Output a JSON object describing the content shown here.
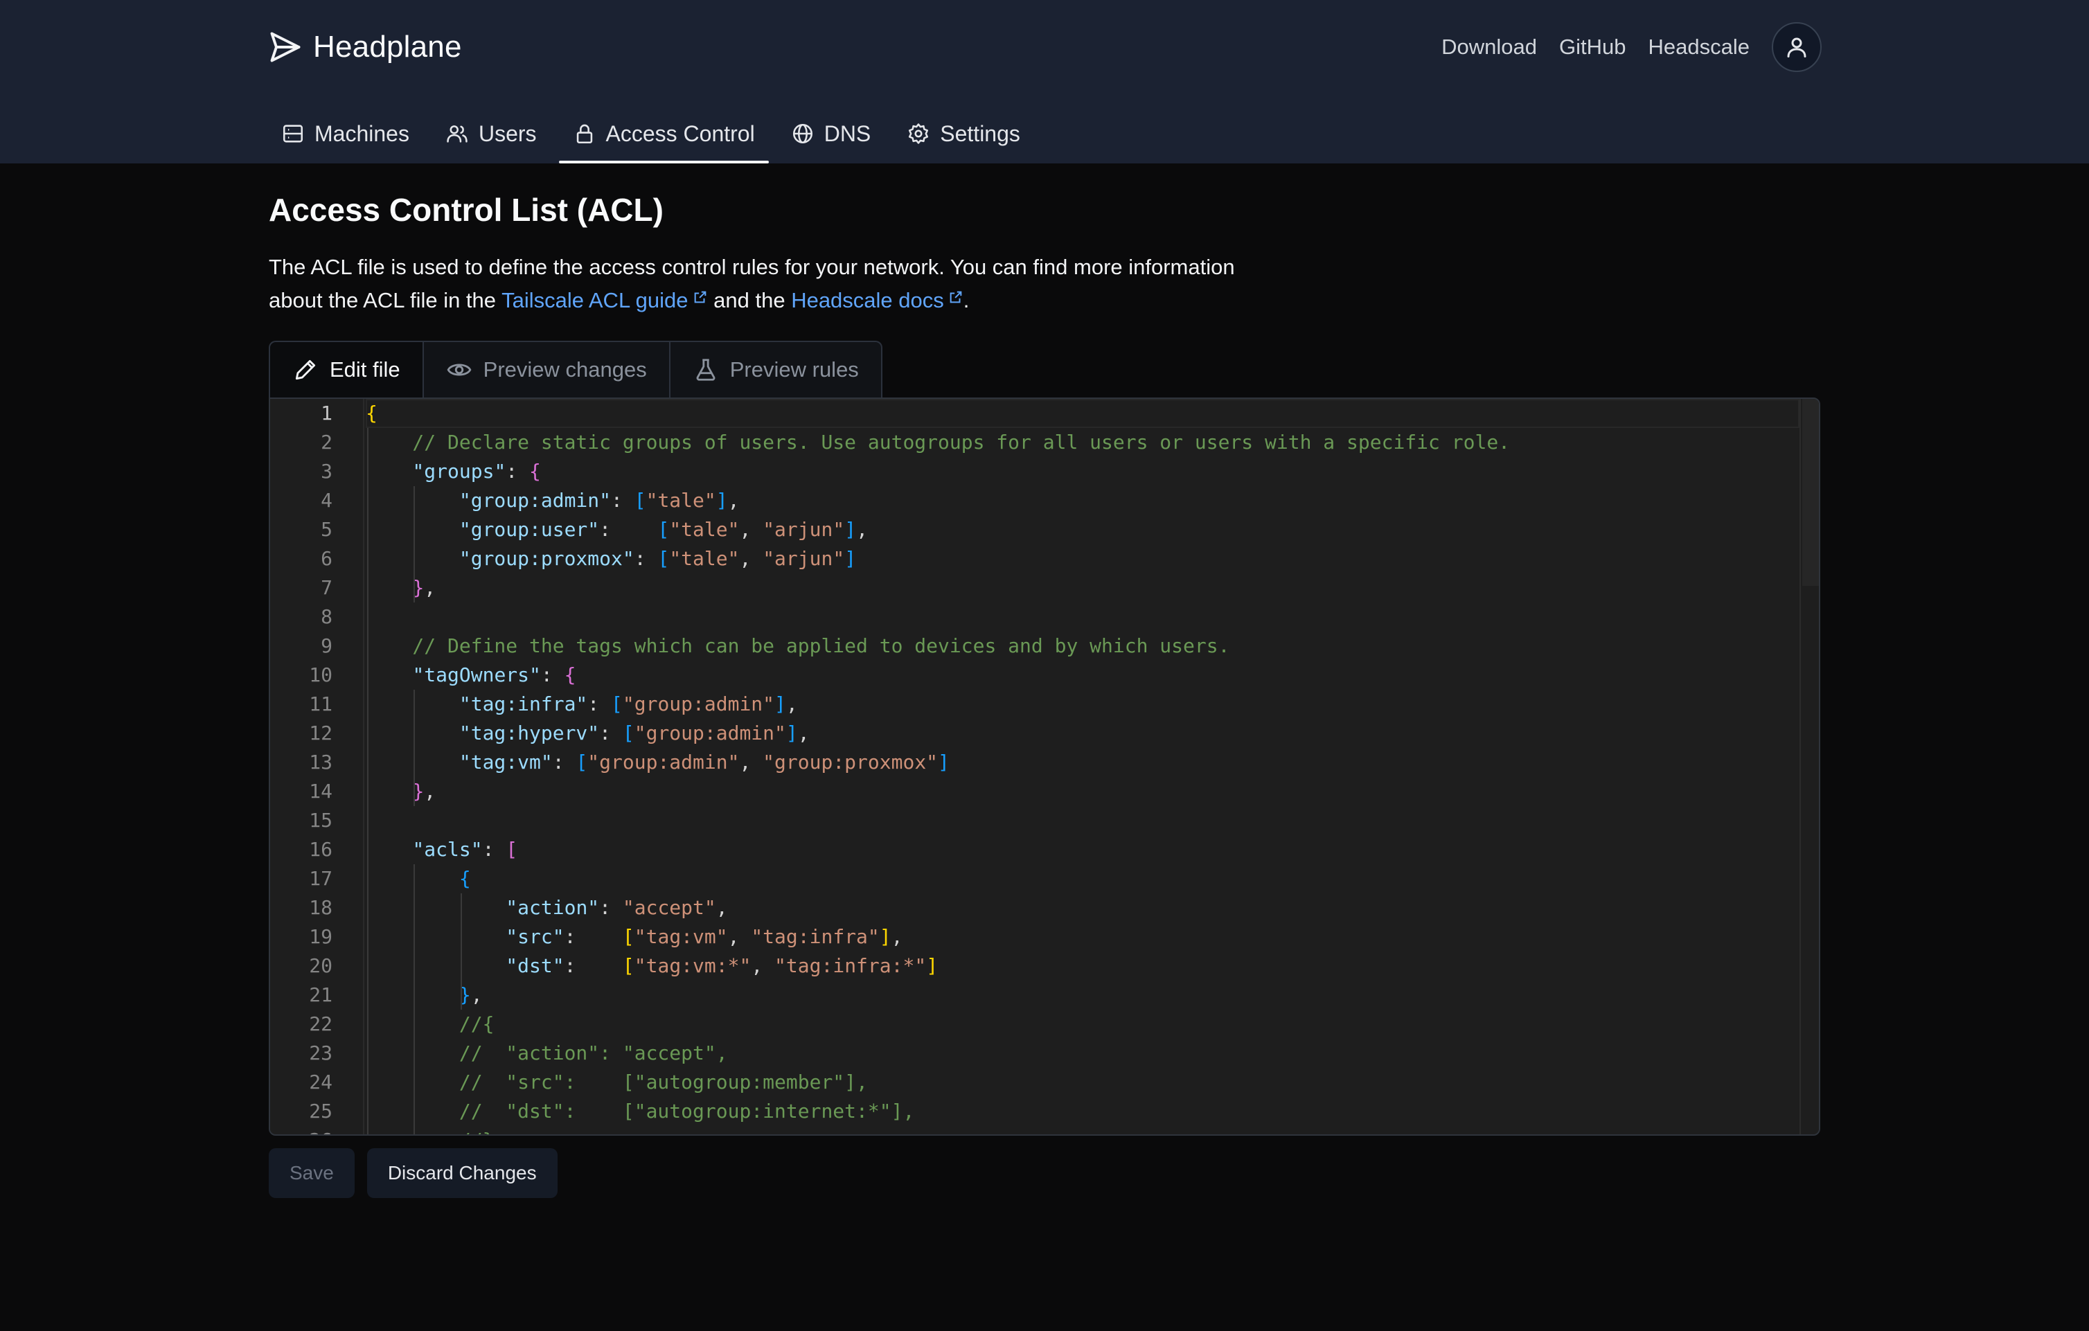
{
  "app": {
    "name": "Headplane",
    "top_links": [
      "Download",
      "GitHub",
      "Headscale"
    ]
  },
  "nav": {
    "tabs": [
      {
        "label": "Machines",
        "icon": "server-icon"
      },
      {
        "label": "Users",
        "icon": "users-icon"
      },
      {
        "label": "Access Control",
        "icon": "lock-icon",
        "active": true
      },
      {
        "label": "DNS",
        "icon": "globe-icon"
      },
      {
        "label": "Settings",
        "icon": "gear-icon"
      }
    ]
  },
  "page": {
    "title": "Access Control List (ACL)",
    "intro_text_1": "The ACL file is used to define the access control rules for your network. You can find more information about the ACL file in the",
    "intro_link_1": "Tailscale ACL guide",
    "intro_text_2": "and the",
    "intro_link_2": "Headscale docs",
    "intro_text_3": "."
  },
  "editor_tabs": [
    {
      "label": "Edit file",
      "icon": "pencil-icon",
      "active": true
    },
    {
      "label": "Preview changes",
      "icon": "eye-icon"
    },
    {
      "label": "Preview rules",
      "icon": "flask-icon"
    }
  ],
  "editor": {
    "lines": [
      [
        [
          "{",
          "brace"
        ]
      ],
      [
        [
          "    // Declare static groups of users. Use autogroups for all users or users with a specific role.",
          "comment"
        ]
      ],
      [
        [
          "    ",
          "punc"
        ],
        [
          "\"groups\"",
          "key"
        ],
        [
          ": ",
          "punc"
        ],
        [
          "{",
          "curly"
        ]
      ],
      [
        [
          "        ",
          "punc"
        ],
        [
          "\"group:admin\"",
          "key"
        ],
        [
          ": ",
          "punc"
        ],
        [
          "[",
          "bracket"
        ],
        [
          "\"tale\"",
          "str"
        ],
        [
          "]",
          "bracket"
        ],
        [
          ",",
          "punc"
        ]
      ],
      [
        [
          "        ",
          "punc"
        ],
        [
          "\"group:user\"",
          "key"
        ],
        [
          ":    ",
          "punc"
        ],
        [
          "[",
          "bracket"
        ],
        [
          "\"tale\"",
          "str"
        ],
        [
          ", ",
          "punc"
        ],
        [
          "\"arjun\"",
          "str"
        ],
        [
          "]",
          "bracket"
        ],
        [
          ",",
          "punc"
        ]
      ],
      [
        [
          "        ",
          "punc"
        ],
        [
          "\"group:proxmox\"",
          "key"
        ],
        [
          ": ",
          "punc"
        ],
        [
          "[",
          "bracket"
        ],
        [
          "\"tale\"",
          "str"
        ],
        [
          ", ",
          "punc"
        ],
        [
          "\"arjun\"",
          "str"
        ],
        [
          "]",
          "bracket"
        ]
      ],
      [
        [
          "    ",
          "punc"
        ],
        [
          "}",
          "curly"
        ],
        [
          ",",
          "punc"
        ]
      ],
      [],
      [
        [
          "    // Define the tags which can be applied to devices and by which users.",
          "comment"
        ]
      ],
      [
        [
          "    ",
          "punc"
        ],
        [
          "\"tagOwners\"",
          "key"
        ],
        [
          ": ",
          "punc"
        ],
        [
          "{",
          "curly"
        ]
      ],
      [
        [
          "        ",
          "punc"
        ],
        [
          "\"tag:infra\"",
          "key"
        ],
        [
          ": ",
          "punc"
        ],
        [
          "[",
          "bracket"
        ],
        [
          "\"group:admin\"",
          "str"
        ],
        [
          "]",
          "bracket"
        ],
        [
          ",",
          "punc"
        ]
      ],
      [
        [
          "        ",
          "punc"
        ],
        [
          "\"tag:hyperv\"",
          "key"
        ],
        [
          ": ",
          "punc"
        ],
        [
          "[",
          "bracket"
        ],
        [
          "\"group:admin\"",
          "str"
        ],
        [
          "]",
          "bracket"
        ],
        [
          ",",
          "punc"
        ]
      ],
      [
        [
          "        ",
          "punc"
        ],
        [
          "\"tag:vm\"",
          "key"
        ],
        [
          ": ",
          "punc"
        ],
        [
          "[",
          "bracket"
        ],
        [
          "\"group:admin\"",
          "str"
        ],
        [
          ", ",
          "punc"
        ],
        [
          "\"group:proxmox\"",
          "str"
        ],
        [
          "]",
          "bracket"
        ]
      ],
      [
        [
          "    ",
          "punc"
        ],
        [
          "}",
          "curly"
        ],
        [
          ",",
          "punc"
        ]
      ],
      [],
      [
        [
          "    ",
          "punc"
        ],
        [
          "\"acls\"",
          "key"
        ],
        [
          ": ",
          "punc"
        ],
        [
          "[",
          "curly"
        ]
      ],
      [
        [
          "        ",
          "punc"
        ],
        [
          "{",
          "bracket"
        ]
      ],
      [
        [
          "            ",
          "punc"
        ],
        [
          "\"action\"",
          "key"
        ],
        [
          ": ",
          "punc"
        ],
        [
          "\"accept\"",
          "str"
        ],
        [
          ",",
          "punc"
        ]
      ],
      [
        [
          "            ",
          "punc"
        ],
        [
          "\"src\"",
          "key"
        ],
        [
          ":    ",
          "punc"
        ],
        [
          "[",
          "brace"
        ],
        [
          "\"tag:vm\"",
          "str"
        ],
        [
          ", ",
          "punc"
        ],
        [
          "\"tag:infra\"",
          "str"
        ],
        [
          "]",
          "brace"
        ],
        [
          ",",
          "punc"
        ]
      ],
      [
        [
          "            ",
          "punc"
        ],
        [
          "\"dst\"",
          "key"
        ],
        [
          ":    ",
          "punc"
        ],
        [
          "[",
          "brace"
        ],
        [
          "\"tag:vm:*\"",
          "str"
        ],
        [
          ", ",
          "punc"
        ],
        [
          "\"tag:infra:*\"",
          "str"
        ],
        [
          "]",
          "brace"
        ]
      ],
      [
        [
          "        ",
          "punc"
        ],
        [
          "}",
          "bracket"
        ],
        [
          ",",
          "punc"
        ]
      ],
      [
        [
          "        //{",
          "comment"
        ]
      ],
      [
        [
          "        //  \"action\": \"accept\",",
          "comment"
        ]
      ],
      [
        [
          "        //  \"src\":    [\"autogroup:member\"],",
          "comment"
        ]
      ],
      [
        [
          "        //  \"dst\":    [\"autogroup:internet:*\"],",
          "comment"
        ]
      ],
      [
        [
          "        //},",
          "comment"
        ]
      ]
    ]
  },
  "actions": {
    "save": "Save",
    "discard": "Discard Changes"
  }
}
